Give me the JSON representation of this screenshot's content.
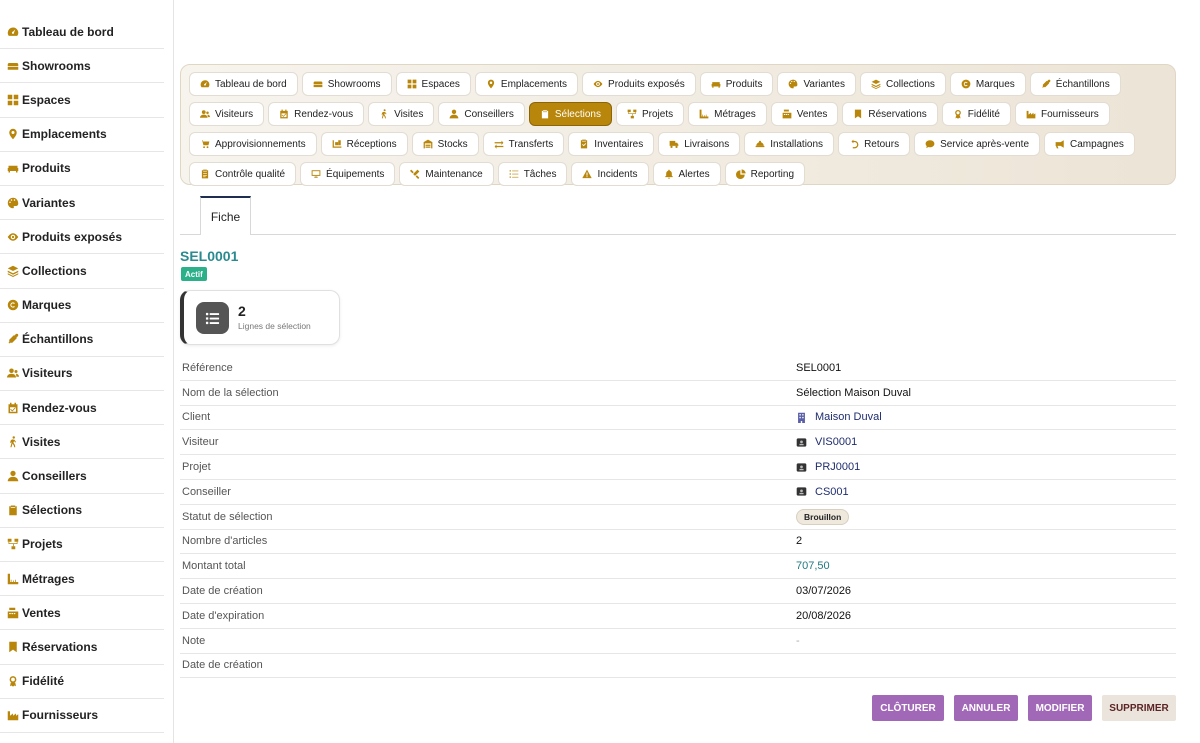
{
  "sidebar": {
    "items": [
      {
        "label": "Tableau de bord",
        "icon": "gauge-icon"
      },
      {
        "label": "Showrooms",
        "icon": "sofa-icon"
      },
      {
        "label": "Espaces",
        "icon": "grid-icon"
      },
      {
        "label": "Emplacements",
        "icon": "pin-icon"
      },
      {
        "label": "Produits",
        "icon": "couch-icon"
      },
      {
        "label": "Variantes",
        "icon": "palette-icon"
      },
      {
        "label": "Produits exposés",
        "icon": "eye-icon"
      },
      {
        "label": "Collections",
        "icon": "layers-icon"
      },
      {
        "label": "Marques",
        "icon": "copyright-icon"
      },
      {
        "label": "Échantillons",
        "icon": "eyedropper-icon"
      },
      {
        "label": "Visiteurs",
        "icon": "user-group-icon"
      },
      {
        "label": "Rendez-vous",
        "icon": "calendar-icon"
      },
      {
        "label": "Visites",
        "icon": "walking-icon"
      },
      {
        "label": "Conseillers",
        "icon": "user-tie-icon"
      },
      {
        "label": "Sélections",
        "icon": "clipboard-icon"
      },
      {
        "label": "Projets",
        "icon": "diagram-icon"
      },
      {
        "label": "Métrages",
        "icon": "ruler-icon"
      },
      {
        "label": "Ventes",
        "icon": "register-icon"
      },
      {
        "label": "Réservations",
        "icon": "bookmark-icon"
      },
      {
        "label": "Fidélité",
        "icon": "award-icon"
      },
      {
        "label": "Fournisseurs",
        "icon": "industry-icon"
      }
    ]
  },
  "toolbar": {
    "items": [
      {
        "label": "Tableau de bord",
        "icon": "gauge-icon"
      },
      {
        "label": "Showrooms",
        "icon": "sofa-icon"
      },
      {
        "label": "Espaces",
        "icon": "grid-icon"
      },
      {
        "label": "Emplacements",
        "icon": "pin-icon"
      },
      {
        "label": "Produits exposés",
        "icon": "eye-icon"
      },
      {
        "label": "Produits",
        "icon": "couch-icon"
      },
      {
        "label": "Variantes",
        "icon": "palette-icon"
      },
      {
        "label": "Collections",
        "icon": "layers-icon"
      },
      {
        "label": "Marques",
        "icon": "copyright-icon"
      },
      {
        "label": "Échantillons",
        "icon": "eyedropper-icon"
      },
      {
        "label": "Visiteurs",
        "icon": "user-group-icon"
      },
      {
        "label": "Rendez-vous",
        "icon": "calendar-icon"
      },
      {
        "label": "Visites",
        "icon": "walking-icon"
      },
      {
        "label": "Conseillers",
        "icon": "user-tie-icon"
      },
      {
        "label": "Sélections",
        "icon": "clipboard-icon",
        "active": true
      },
      {
        "label": "Projets",
        "icon": "diagram-icon"
      },
      {
        "label": "Métrages",
        "icon": "ruler-icon"
      },
      {
        "label": "Ventes",
        "icon": "register-icon"
      },
      {
        "label": "Réservations",
        "icon": "bookmark-icon"
      },
      {
        "label": "Fidélité",
        "icon": "award-icon"
      },
      {
        "label": "Fournisseurs",
        "icon": "industry-icon"
      },
      {
        "label": "Approvisionnements",
        "icon": "cart-icon"
      },
      {
        "label": "Réceptions",
        "icon": "truck-loading-icon"
      },
      {
        "label": "Stocks",
        "icon": "warehouse-icon"
      },
      {
        "label": "Transferts",
        "icon": "exchange-icon"
      },
      {
        "label": "Inventaires",
        "icon": "clipboard-check-icon"
      },
      {
        "label": "Livraisons",
        "icon": "truck-icon"
      },
      {
        "label": "Installations",
        "icon": "hard-hat-icon"
      },
      {
        "label": "Retours",
        "icon": "undo-icon"
      },
      {
        "label": "Service après-vente",
        "icon": "comment-icon"
      },
      {
        "label": "Campagnes",
        "icon": "megaphone-icon"
      },
      {
        "label": "Contrôle qualité",
        "icon": "clipboard-list-icon"
      },
      {
        "label": "Équipements",
        "icon": "desktop-icon"
      },
      {
        "label": "Maintenance",
        "icon": "tools-icon"
      },
      {
        "label": "Tâches",
        "icon": "tasks-icon"
      },
      {
        "label": "Incidents",
        "icon": "warning-icon"
      },
      {
        "label": "Alertes",
        "icon": "bell-icon"
      },
      {
        "label": "Reporting",
        "icon": "chart-pie-icon"
      }
    ]
  },
  "tabs": [
    {
      "label": "Fiche"
    }
  ],
  "record": {
    "title": "SEL0001",
    "status_badge": "Actif",
    "card": {
      "value": "2",
      "label": "Lignes de sélection",
      "icon": "list-icon"
    }
  },
  "fields": [
    {
      "label": "Référence",
      "value": "SEL0001",
      "type": "text"
    },
    {
      "label": "Nom de la sélection",
      "value": "Sélection Maison Duval",
      "type": "text"
    },
    {
      "label": "Client",
      "value": "Maison Duval",
      "type": "link",
      "icon": "building-icon"
    },
    {
      "label": "Visiteur",
      "value": "VIS0001",
      "type": "link",
      "icon": "id-card-icon"
    },
    {
      "label": "Projet",
      "value": "PRJ0001",
      "type": "link",
      "icon": "id-card-icon"
    },
    {
      "label": "Conseiller",
      "value": "CS001",
      "type": "link",
      "icon": "id-card-icon"
    },
    {
      "label": "Statut de sélection",
      "value": "Brouillon",
      "type": "tag"
    },
    {
      "label": "Nombre d'articles",
      "value": "2",
      "type": "text"
    },
    {
      "label": "Montant total",
      "value": "707,50",
      "type": "money"
    },
    {
      "label": "Date de création",
      "value": "03/07/2026",
      "type": "text"
    },
    {
      "label": "Date d'expiration",
      "value": "20/08/2026",
      "type": "text"
    },
    {
      "label": "Note",
      "value": "-",
      "type": "muted"
    },
    {
      "label": "Date de création",
      "value": "",
      "type": "text"
    }
  ],
  "actions": {
    "close_label": "CLÔTURER",
    "cancel_label": "ANNULER",
    "edit_label": "MODIFIER",
    "delete_label": "SUPPRIMER"
  },
  "colors": {
    "accent": "#b8860b",
    "title": "#2a8a8f",
    "badge": "#2bb08a",
    "button_purple": "#a168b8",
    "link": "#1f2d6e"
  }
}
